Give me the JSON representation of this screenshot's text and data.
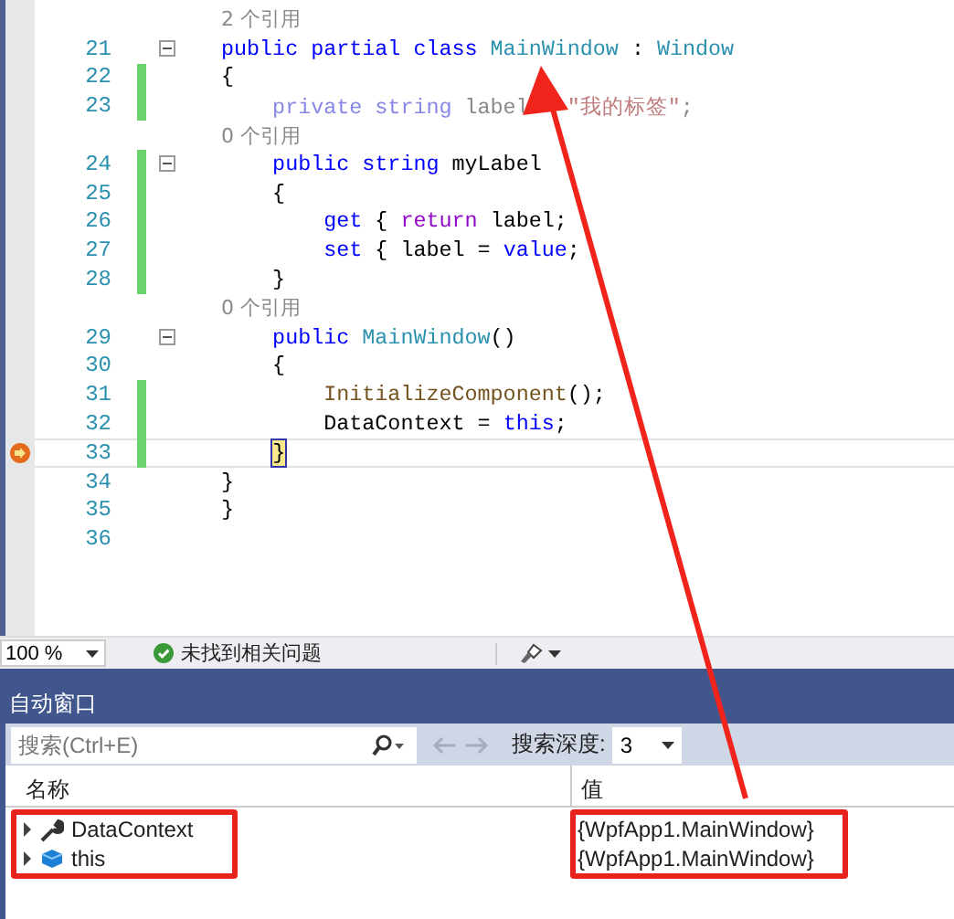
{
  "editor": {
    "lines": [
      {
        "kind": "codelens",
        "text": "2 个引用"
      },
      {
        "kind": "code",
        "number": "21",
        "fold": true,
        "changed": false,
        "current": false,
        "tokens": [
          {
            "t": "public partial class ",
            "kind": "keyword"
          },
          {
            "t": "MainWindow",
            "kind": "type"
          },
          {
            "t": " : ",
            "kind": "plain"
          },
          {
            "t": "Window",
            "kind": "type"
          }
        ]
      },
      {
        "kind": "code",
        "number": "22",
        "fold": false,
        "changed": true,
        "current": false,
        "tokens": [
          {
            "t": "{",
            "kind": "plain"
          }
        ]
      },
      {
        "kind": "code",
        "number": "23",
        "fold": false,
        "changed": true,
        "current": false,
        "tokens": [
          {
            "t": "    private string ",
            "kind": "faded-keyword"
          },
          {
            "t": "label",
            "kind": "faded"
          },
          {
            "t": "   \"我的标签\"",
            "kind": "faded-string"
          },
          {
            "t": ";",
            "kind": "faded"
          }
        ]
      },
      {
        "kind": "codelens",
        "text": "0 个引用"
      },
      {
        "kind": "code",
        "number": "24",
        "fold": true,
        "changed": true,
        "current": false,
        "tokens": [
          {
            "t": "    public string ",
            "kind": "keyword"
          },
          {
            "t": "myLabel",
            "kind": "plain"
          }
        ]
      },
      {
        "kind": "code",
        "number": "25",
        "fold": false,
        "changed": true,
        "current": false,
        "tokens": [
          {
            "t": "    {",
            "kind": "plain"
          }
        ]
      },
      {
        "kind": "code",
        "number": "26",
        "fold": false,
        "changed": true,
        "current": false,
        "tokens": [
          {
            "t": "        get ",
            "kind": "keyword"
          },
          {
            "t": "{ ",
            "kind": "plain"
          },
          {
            "t": "return ",
            "kind": "control"
          },
          {
            "t": "label;",
            "kind": "plain"
          }
        ]
      },
      {
        "kind": "code",
        "number": "27",
        "fold": false,
        "changed": true,
        "current": false,
        "tokens": [
          {
            "t": "        set ",
            "kind": "keyword"
          },
          {
            "t": "{ label = ",
            "kind": "plain"
          },
          {
            "t": "value",
            "kind": "keyword"
          },
          {
            "t": ";",
            "kind": "plain"
          }
        ]
      },
      {
        "kind": "code",
        "number": "28",
        "fold": false,
        "changed": true,
        "current": false,
        "tokens": [
          {
            "t": "    }",
            "kind": "plain"
          }
        ]
      },
      {
        "kind": "codelens",
        "text": "0 个引用"
      },
      {
        "kind": "code",
        "number": "29",
        "fold": true,
        "changed": false,
        "current": false,
        "tokens": [
          {
            "t": "    public ",
            "kind": "keyword"
          },
          {
            "t": "MainWindow",
            "kind": "type"
          },
          {
            "t": "()",
            "kind": "plain"
          }
        ]
      },
      {
        "kind": "code",
        "number": "30",
        "fold": false,
        "changed": false,
        "current": false,
        "tokens": [
          {
            "t": "    {",
            "kind": "plain"
          }
        ]
      },
      {
        "kind": "code",
        "number": "31",
        "fold": false,
        "changed": true,
        "current": false,
        "tokens": [
          {
            "t": "        InitializeComponent",
            "kind": "method"
          },
          {
            "t": "();",
            "kind": "plain"
          }
        ]
      },
      {
        "kind": "code",
        "number": "32",
        "fold": false,
        "changed": true,
        "current": false,
        "tokens": [
          {
            "t": "        DataContext = ",
            "kind": "plain"
          },
          {
            "t": "this",
            "kind": "keyword"
          },
          {
            "t": ";",
            "kind": "plain"
          }
        ]
      },
      {
        "kind": "code",
        "number": "33",
        "fold": false,
        "changed": true,
        "current": true,
        "tokens": [
          {
            "t": "    }",
            "kind": "brace-match"
          }
        ]
      },
      {
        "kind": "code",
        "number": "34",
        "fold": false,
        "changed": false,
        "current": false,
        "tokens": [
          {
            "t": "}",
            "kind": "plain"
          }
        ]
      },
      {
        "kind": "code",
        "number": "35",
        "fold": false,
        "changed": false,
        "current": false,
        "tokens": [
          {
            "t": "}",
            "kind": "plain"
          }
        ]
      },
      {
        "kind": "code",
        "number": "36",
        "fold": false,
        "changed": false,
        "current": false
      }
    ]
  },
  "status_bar": {
    "zoom": "100 %",
    "issues": "未找到相关问题"
  },
  "autos": {
    "title": "自动窗口",
    "search": {
      "placeholder": "搜索(Ctrl+E)"
    },
    "depth_label": "搜索深度:",
    "depth": "3",
    "columns": [
      "名称",
      "值"
    ],
    "rows": [
      {
        "name": "DataContext",
        "value": "{WpfApp1.MainWindow}",
        "kind": "property",
        "expanded": false
      },
      {
        "name": "this",
        "value": "{WpfApp1.MainWindow}",
        "kind": "object",
        "expanded": false
      }
    ]
  },
  "annotations": {
    "highlight_names": true,
    "highlight_values": true,
    "arrow": true
  }
}
